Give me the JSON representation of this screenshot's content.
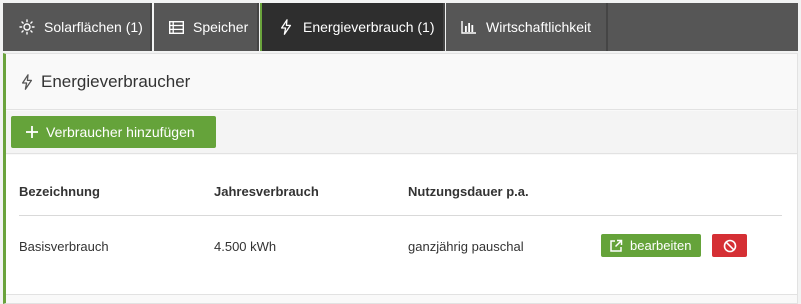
{
  "tabs": [
    {
      "label": "Solarflächen (1)",
      "icon": "sun-icon"
    },
    {
      "label": "Speicher",
      "icon": "storage-list-icon"
    },
    {
      "label": "Energieverbrauch (1)",
      "icon": "lightning-icon",
      "active": true
    },
    {
      "label": "Wirtschaftlichkeit",
      "icon": "bar-chart-icon"
    }
  ],
  "panel": {
    "title": "Energieverbraucher",
    "title_icon": "lightning-icon"
  },
  "toolbar": {
    "add_label": "Verbraucher hinzufügen"
  },
  "table": {
    "columns": [
      "Bezeichnung",
      "Jahresverbrauch",
      "Nutzungsdauer p.a."
    ],
    "rows": [
      {
        "name": "Basisverbrauch",
        "consumption": "4.500 kWh",
        "usage": "ganzjährig pauschal"
      }
    ],
    "edit_label": "bearbeiten"
  },
  "colors": {
    "accent_green": "#65a33a",
    "danger_red": "#d52f34",
    "tab_bg": "#565656",
    "tab_active_bg": "#2e2e2e"
  }
}
